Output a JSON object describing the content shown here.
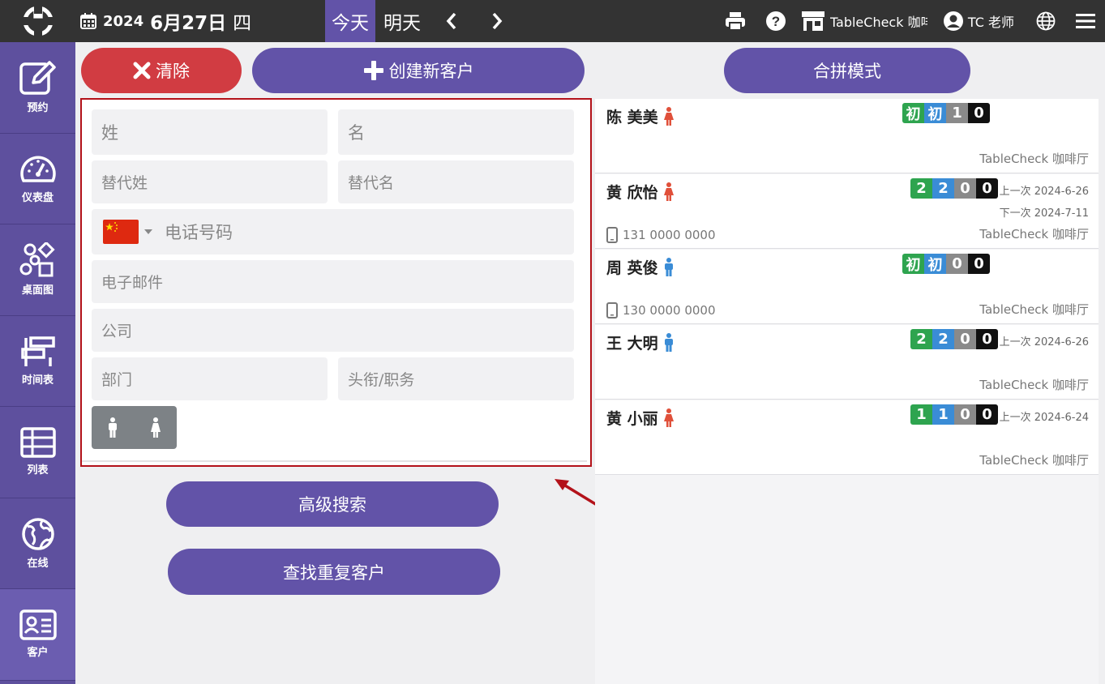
{
  "topbar": {
    "year": "2024",
    "month_day": "6月27日",
    "weekday": "四",
    "today": "今天",
    "tomorrow": "明天",
    "store": "TableCheck 咖啡",
    "user": "TC 老师"
  },
  "sidebar": {
    "items": [
      {
        "label": "预约",
        "icon": "edit-icon"
      },
      {
        "label": "仪表盘",
        "icon": "dashboard-icon"
      },
      {
        "label": "桌面图",
        "icon": "table-map-icon"
      },
      {
        "label": "时间表",
        "icon": "timetable-icon"
      },
      {
        "label": "列表",
        "icon": "list-icon"
      },
      {
        "label": "在线",
        "icon": "globe-icon"
      },
      {
        "label": "客户",
        "icon": "customer-card-icon"
      }
    ]
  },
  "actions": {
    "clear": "清除",
    "create": "创建新客户",
    "merge": "合拼模式",
    "advanced_search": "高级搜索",
    "find_duplicates": "查找重复客户"
  },
  "form": {
    "last_name": "姓",
    "first_name": "名",
    "alt_last_name": "替代姓",
    "alt_first_name": "替代名",
    "phone": "电话号码",
    "email": "电子邮件",
    "company": "公司",
    "department": "部门",
    "title": "头衔/职务"
  },
  "customers": [
    {
      "name": "陈 美美",
      "gender": "female",
      "badges": [
        {
          "t": "初",
          "c": "green"
        },
        {
          "t": "初",
          "c": "blue"
        },
        {
          "t": "1",
          "c": "gray"
        },
        {
          "t": "0",
          "c": "black"
        }
      ],
      "last": "",
      "next": "",
      "phone": "",
      "shop": "TableCheck 咖啡厅"
    },
    {
      "name": "黄 欣怡",
      "gender": "female",
      "badges": [
        {
          "t": "2",
          "c": "green"
        },
        {
          "t": "2",
          "c": "blue"
        },
        {
          "t": "0",
          "c": "gray"
        },
        {
          "t": "0",
          "c": "black"
        }
      ],
      "last": "上一次 2024-6-26",
      "next": "下一次 2024-7-11",
      "phone": "131 0000 0000",
      "shop": "TableCheck 咖啡厅"
    },
    {
      "name": "周 英俊",
      "gender": "male",
      "badges": [
        {
          "t": "初",
          "c": "green"
        },
        {
          "t": "初",
          "c": "blue"
        },
        {
          "t": "0",
          "c": "gray"
        },
        {
          "t": "0",
          "c": "black"
        }
      ],
      "last": "",
      "next": "",
      "phone": "130 0000 0000",
      "shop": "TableCheck 咖啡厅"
    },
    {
      "name": "王 大明",
      "gender": "male",
      "badges": [
        {
          "t": "2",
          "c": "green"
        },
        {
          "t": "2",
          "c": "blue"
        },
        {
          "t": "0",
          "c": "gray"
        },
        {
          "t": "0",
          "c": "black"
        }
      ],
      "last": "上一次 2024-6-26",
      "next": "",
      "phone": "",
      "shop": "TableCheck 咖啡厅"
    },
    {
      "name": "黄 小丽",
      "gender": "female",
      "badges": [
        {
          "t": "1",
          "c": "green"
        },
        {
          "t": "1",
          "c": "blue"
        },
        {
          "t": "0",
          "c": "gray"
        },
        {
          "t": "0",
          "c": "black"
        }
      ],
      "last": "上一次 2024-6-24",
      "next": "",
      "phone": "",
      "shop": "TableCheck 咖啡厅"
    }
  ],
  "colors": {
    "brand": "#6253a8",
    "danger": "#d13c42",
    "female": "#e0503a",
    "male": "#3a8cd6",
    "highlight": "#b3121a"
  }
}
